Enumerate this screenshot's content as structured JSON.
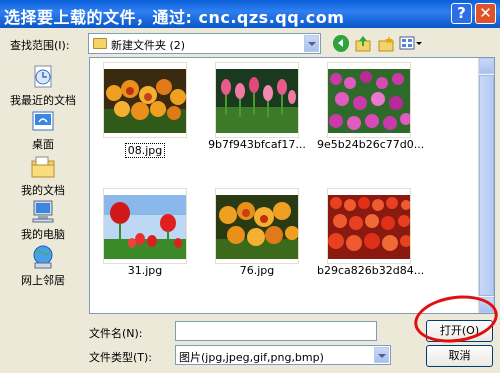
{
  "window": {
    "title": "选择要上载的文件，通过: cnc.qzs.qq.com",
    "help_label": "?",
    "close_label": "✕"
  },
  "toolbar": {
    "look_in_label": "查找范围(I):",
    "look_in_value": "新建文件夹 (2)",
    "icons": [
      "back-icon",
      "up-folder-icon",
      "new-folder-icon",
      "views-menu-icon"
    ]
  },
  "places": [
    {
      "label": "我最近的文档",
      "icon": "recent-documents-icon"
    },
    {
      "label": "桌面",
      "icon": "desktop-icon"
    },
    {
      "label": "我的文档",
      "icon": "my-documents-icon"
    },
    {
      "label": "我的电脑",
      "icon": "my-computer-icon"
    },
    {
      "label": "网上邻居",
      "icon": "network-places-icon"
    }
  ],
  "files": [
    {
      "name": "08.jpg",
      "selected": true
    },
    {
      "name": "9b7f943bfcaf17...",
      "selected": false
    },
    {
      "name": "9e5b24b26c77d0...",
      "selected": false
    },
    {
      "name": "31.jpg",
      "selected": false
    },
    {
      "name": "76.jpg",
      "selected": false
    },
    {
      "name": "b29ca826b32d84...",
      "selected": false
    }
  ],
  "form": {
    "file_name_label": "文件名(N):",
    "file_name_value": "",
    "file_type_label": "文件类型(T):",
    "file_type_value": "图片(jpg,jpeg,gif,png,bmp)",
    "open_label": "打开(O)",
    "cancel_label": "取消"
  }
}
